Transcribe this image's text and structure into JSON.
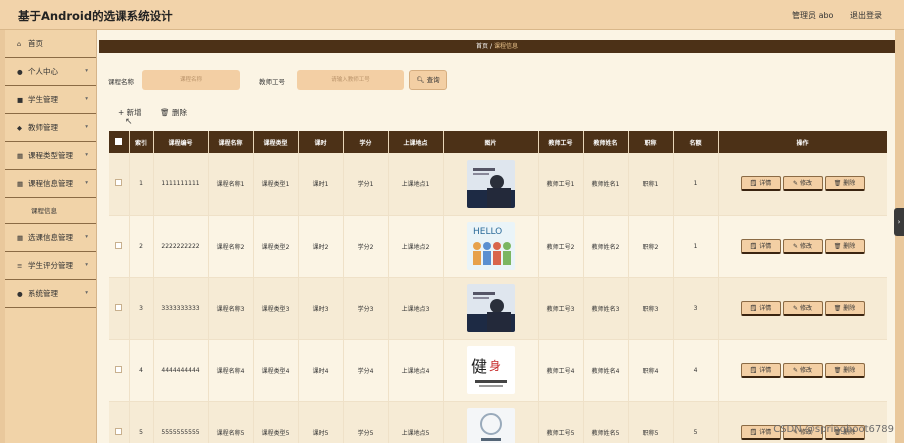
{
  "app": {
    "title": "基于Android的选课系统设计",
    "user_label": "管理员 abo",
    "logout_label": "退出登录"
  },
  "sidebar": {
    "items": [
      {
        "label": "首页",
        "icon": "home-icon",
        "glyph": "⌂",
        "has_chevron": false
      },
      {
        "label": "个人中心",
        "icon": "user-icon",
        "glyph": "●",
        "has_chevron": true
      },
      {
        "label": "学生管理",
        "icon": "student-icon",
        "glyph": "■",
        "has_chevron": true
      },
      {
        "label": "教师管理",
        "icon": "teacher-icon",
        "glyph": "◆",
        "has_chevron": true
      },
      {
        "label": "课程类型管理",
        "icon": "grid-icon",
        "glyph": "▦",
        "has_chevron": true
      },
      {
        "label": "课程信息管理",
        "icon": "grid-icon",
        "glyph": "▦",
        "has_chevron": true
      },
      {
        "label": "课程信息",
        "sub": true
      },
      {
        "label": "选课信息管理",
        "icon": "grid-icon",
        "glyph": "▦",
        "has_chevron": true
      },
      {
        "label": "学生评分管理",
        "icon": "list-icon",
        "glyph": "≡",
        "has_chevron": true
      },
      {
        "label": "系统管理",
        "icon": "settings-icon",
        "glyph": "●",
        "has_chevron": true
      }
    ]
  },
  "breadcrumb": {
    "home": "首页",
    "separator": "/",
    "current": "课程信息"
  },
  "search": {
    "course_name_label": "课程名称",
    "course_name_placeholder": "课程名称",
    "teacher_no_label": "教师工号",
    "teacher_no_placeholder": "请输入教师工号",
    "button_label": "查询"
  },
  "toolbar": {
    "add_label": "+ 新增",
    "delete_label": "🗑 删除"
  },
  "table": {
    "headers": [
      "索引",
      "课程编号",
      "课程名称",
      "课程类型",
      "课时",
      "学分",
      "上课地点",
      "图片",
      "教师工号",
      "教师姓名",
      "职称",
      "名额",
      "操作"
    ],
    "rows": [
      {
        "index": "1",
        "code": "1111111111",
        "name": "课程名称1",
        "type": "课程类型1",
        "hours": "课时1",
        "credit": "学分1",
        "place": "上课地点1",
        "teacher_no": "教师工号1",
        "teacher_name": "教师姓名1",
        "title": "职称1",
        "quota": "1"
      },
      {
        "index": "2",
        "code": "2222222222",
        "name": "课程名称2",
        "type": "课程类型2",
        "hours": "课时2",
        "credit": "学分2",
        "place": "上课地点2",
        "teacher_no": "教师工号2",
        "teacher_name": "教师姓名2",
        "title": "职称2",
        "quota": "1"
      },
      {
        "index": "3",
        "code": "3333333333",
        "name": "课程名称3",
        "type": "课程类型3",
        "hours": "课时3",
        "credit": "学分3",
        "place": "上课地点3",
        "teacher_no": "教师工号3",
        "teacher_name": "教师姓名3",
        "title": "职称3",
        "quota": "3"
      },
      {
        "index": "4",
        "code": "4444444444",
        "name": "课程名称4",
        "type": "课程类型4",
        "hours": "课时4",
        "credit": "学分4",
        "place": "上课地点4",
        "teacher_no": "教师工号4",
        "teacher_name": "教师姓名4",
        "title": "职称4",
        "quota": "4"
      },
      {
        "index": "5",
        "code": "5555555555",
        "name": "课程名称5",
        "type": "课程类型5",
        "hours": "课时5",
        "credit": "学分5",
        "place": "上课地点5",
        "teacher_no": "教师工号5",
        "teacher_name": "教师姓名5",
        "title": "职称5",
        "quota": "5"
      }
    ],
    "op_labels": {
      "detail": "详情",
      "edit": "修改",
      "delete": "删除"
    }
  },
  "watermark": "CSDN @springboot6789",
  "colors": {
    "header_bg": "#4c3117",
    "accent": "#f3cfa4",
    "sidebar_bg": "#f1d3a8"
  }
}
